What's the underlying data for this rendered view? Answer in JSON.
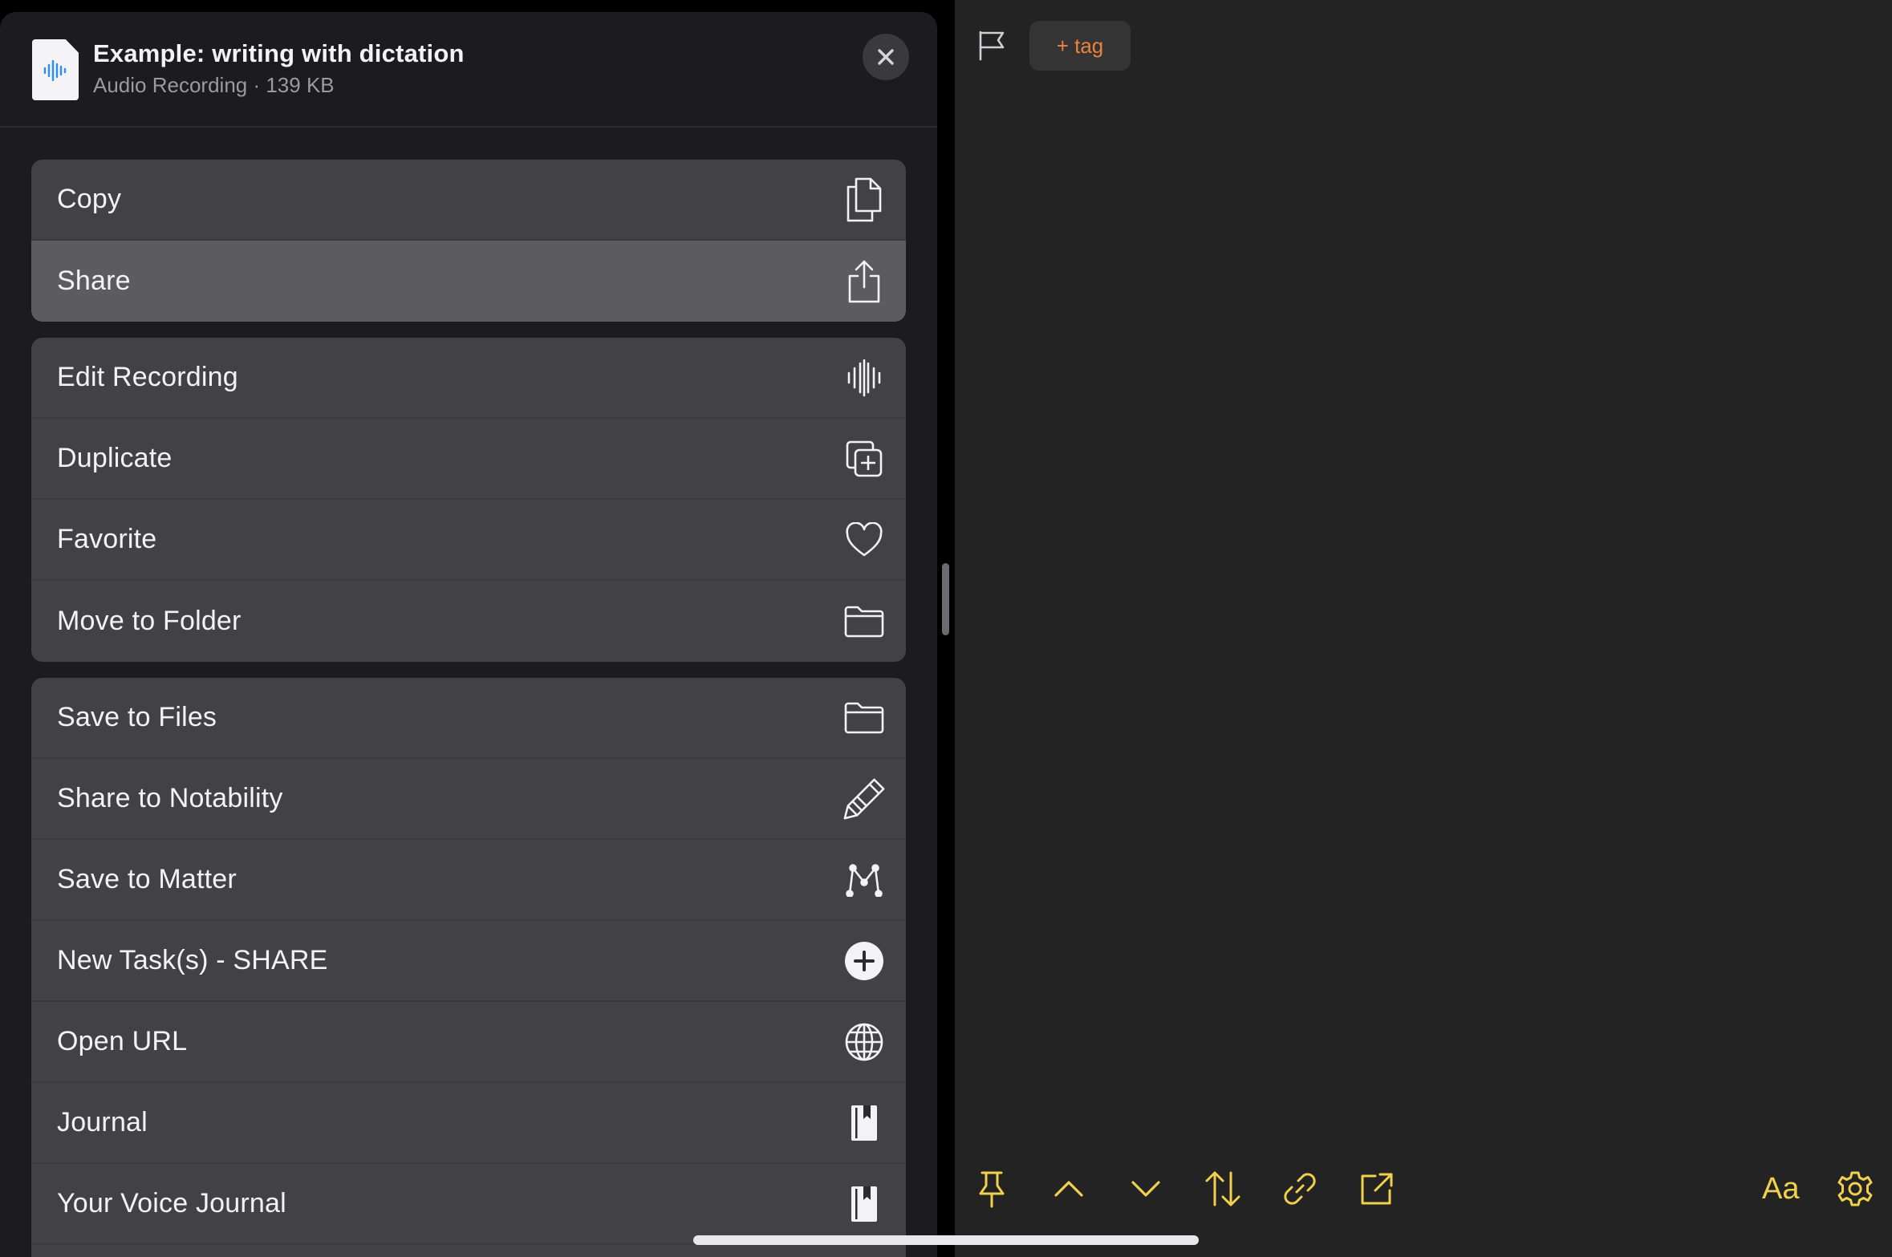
{
  "header": {
    "file_title": "Example: writing with dictation",
    "file_subtitle": "Audio Recording · 139 KB",
    "file_icon": "audio-waveform-icon",
    "close_icon": "close-icon"
  },
  "groups": [
    {
      "rows": [
        {
          "label": "Copy",
          "icon": "copy-icon"
        },
        {
          "label": "Share",
          "icon": "share-icon",
          "active": true
        }
      ]
    },
    {
      "rows": [
        {
          "label": "Edit Recording",
          "icon": "waveform-icon"
        },
        {
          "label": "Duplicate",
          "icon": "duplicate-icon"
        },
        {
          "label": "Favorite",
          "icon": "heart-icon"
        },
        {
          "label": "Move to Folder",
          "icon": "folder-icon"
        }
      ]
    },
    {
      "rows": [
        {
          "label": "Save to Files",
          "icon": "folder-icon"
        },
        {
          "label": "Share to Notability",
          "icon": "pencil-icon"
        },
        {
          "label": "Save to Matter",
          "icon": "matter-icon"
        },
        {
          "label": "New Task(s) - SHARE",
          "icon": "plus-circle-icon"
        },
        {
          "label": "Open URL",
          "icon": "globe-icon"
        },
        {
          "label": "Journal",
          "icon": "journal-icon"
        },
        {
          "label": "Your Voice Journal",
          "icon": "journal-icon"
        }
      ]
    }
  ],
  "note": {
    "tag_label": "+ tag",
    "flag_icon": "flag-icon",
    "toolbar": {
      "items": [
        "pin-icon",
        "chevron-up-icon",
        "chevron-down-icon",
        "sort-icon",
        "link-icon",
        "external-link-icon"
      ],
      "font_label": "Aa",
      "settings_icon": "gear-icon"
    }
  },
  "colors": {
    "sheet_bg": "#1c1c1e",
    "row_bg": "#424245",
    "row_active_bg": "#5c5c5f",
    "note_bg": "#232323",
    "tag_accent": "#e9833e",
    "toolbar_accent": "#f1d14b"
  }
}
